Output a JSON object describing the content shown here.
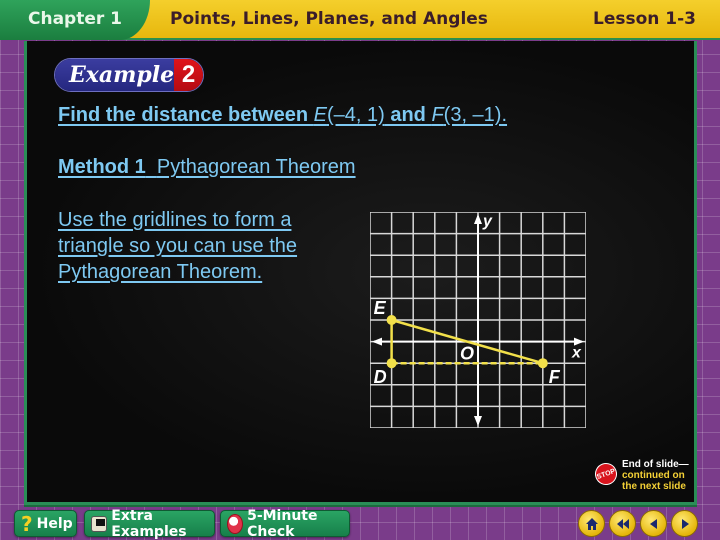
{
  "header": {
    "chapter": "Chapter 1",
    "title": "Points, Lines, Planes, and Angles",
    "lesson": "Lesson 1-3"
  },
  "example": {
    "label": "Example",
    "number": "2"
  },
  "question": {
    "prefix": "Find the distance between ",
    "point1_name": "E",
    "point1_coords": "(–4, 1)",
    "middle": " and ",
    "point2_name": "F",
    "point2_coords": "(3, –1)",
    "suffix": "."
  },
  "method": {
    "label": "Method 1",
    "name": "Pythagorean Theorem"
  },
  "instruction": "Use the gridlines to form a triangle so you can use the Pythagorean Theorem.",
  "graph": {
    "x_axis_label": "x",
    "y_axis_label": "y",
    "origin_label": "O",
    "x_range": [
      -5,
      5
    ],
    "y_range": [
      -4,
      6
    ],
    "points": [
      {
        "name": "E",
        "x": -4,
        "y": 1
      },
      {
        "name": "D",
        "x": -4,
        "y": -1
      },
      {
        "name": "F",
        "x": 3,
        "y": -1
      }
    ],
    "segments": [
      {
        "from": "E",
        "to": "F",
        "style": "solid"
      },
      {
        "from": "E",
        "to": "D",
        "style": "solid"
      },
      {
        "from": "D",
        "to": "F",
        "style": "dashed"
      }
    ],
    "color": "#f2e04a"
  },
  "stop_note": {
    "icon": "stop-sign-icon",
    "icon_text": "STOP",
    "line1": "End of slide—",
    "line2": "continued on",
    "line3": "the next slide"
  },
  "bottom_bar": {
    "help": "Help",
    "extra_examples": "Extra Examples",
    "five_minute_check": "5-Minute Check"
  },
  "nav": [
    "home",
    "first-slide",
    "previous-slide",
    "next-slide"
  ]
}
